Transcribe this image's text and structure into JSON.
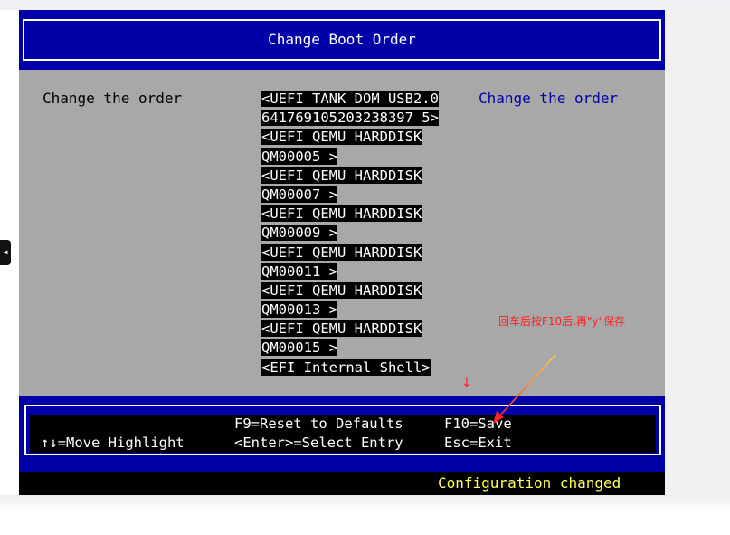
{
  "title": "Change Boot Order",
  "left_label": "Change the order",
  "help_text": "Change the order",
  "boot_list": [
    "<UEFI TANK DOM USB2.0",
    "641769105203238397 5>",
    "<UEFI QEMU HARDDISK",
    "QM00005 >",
    "<UEFI QEMU HARDDISK",
    "QM00007 >",
    "<UEFI QEMU HARDDISK",
    "QM00009 >",
    "<UEFI QEMU HARDDISK",
    "QM00011 >",
    "<UEFI QEMU HARDDISK",
    "QM00013 >",
    "<UEFI QEMU HARDDISK",
    "QM00015 >",
    "<EFI Internal Shell>"
  ],
  "footer": {
    "move_highlight": "↑↓=Move Highlight",
    "reset_defaults": "F9=Reset to Defaults",
    "select_entry": "<Enter>=Select Entry",
    "save": "F10=Save",
    "exit": "Esc=Exit"
  },
  "status": "Configuration changed",
  "annotation": {
    "text": "回车后按F10后,再\"y\"保存",
    "down_arrow": "↓"
  },
  "colors": {
    "bios_blue": "#0000a8",
    "bios_gray": "#a8a8a8",
    "status_yellow": "#ffff55",
    "annotation_red": "#ff2222"
  }
}
